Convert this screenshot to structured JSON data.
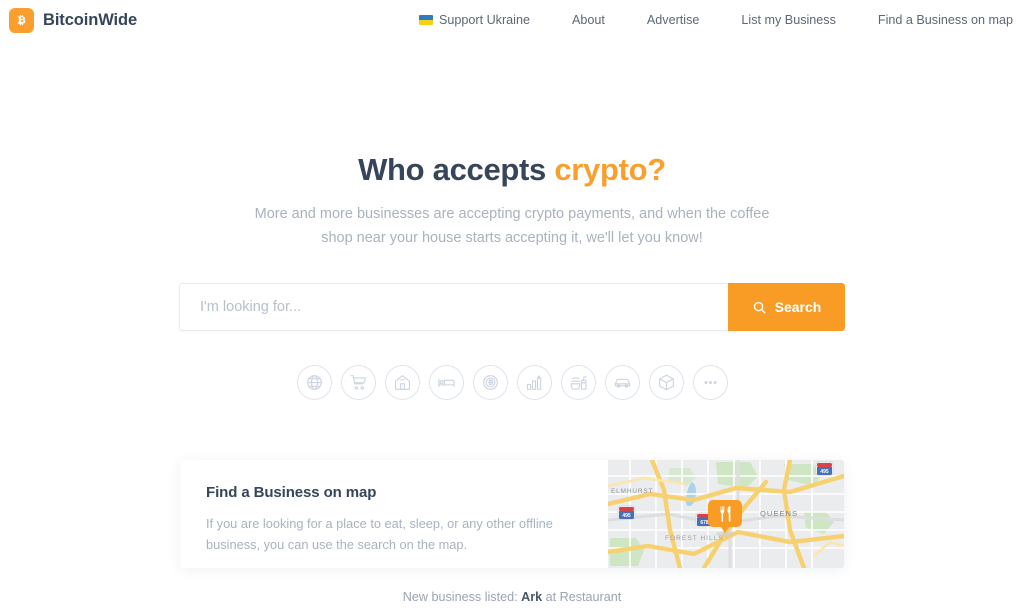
{
  "brand": {
    "name": "BitcoinWide",
    "logo_icon": "bitcoin-logo-icon",
    "logo_color": "#fa9f2e"
  },
  "nav": {
    "items": [
      {
        "label": "Support Ukraine",
        "icon": "ukraine-flag-icon"
      },
      {
        "label": "About",
        "icon": ""
      },
      {
        "label": "Advertise",
        "icon": ""
      },
      {
        "label": "List my Business",
        "icon": ""
      },
      {
        "label": "Find a Business on map",
        "icon": ""
      }
    ]
  },
  "hero": {
    "title_main": "Who accepts",
    "title_accent": "crypto?",
    "accent_color": "#fa9f2e",
    "subtitle_line1": "More and more businesses are accepting crypto payments, and when the coffee",
    "subtitle_line2": "shop near your house starts accepting it, we'll let you know!"
  },
  "search": {
    "placeholder": "I'm looking for...",
    "value": "",
    "button_label": "Search",
    "button_icon": "search-icon",
    "button_color": "#f89c26"
  },
  "categories": [
    {
      "name": "globe",
      "icon": "globe-icon"
    },
    {
      "name": "shopping",
      "icon": "shopping-cart-icon"
    },
    {
      "name": "home",
      "icon": "house-icon"
    },
    {
      "name": "lodging",
      "icon": "bed-icon"
    },
    {
      "name": "crypto",
      "icon": "bitcoin-coin-icon"
    },
    {
      "name": "finance",
      "icon": "bar-chart-arrow-icon"
    },
    {
      "name": "food",
      "icon": "fast-food-icon"
    },
    {
      "name": "automotive",
      "icon": "car-icon"
    },
    {
      "name": "goods",
      "icon": "box-icon"
    },
    {
      "name": "more",
      "icon": "ellipsis-icon"
    }
  ],
  "map_card": {
    "title": "Find a Business on map",
    "text_line1": "If you are looking for a place to eat, sleep, or any other offline",
    "text_line2": "business, you can use the search on the map.",
    "marker_icon": "restaurant-pin-icon",
    "marker_color": "#f89c26",
    "map_labels": [
      "ELMHURST",
      "QUEENS",
      "FOREST HILLS"
    ],
    "map_shields": [
      "495",
      "678",
      "495"
    ]
  },
  "ticker": {
    "prefix": "New business listed:",
    "business": "Ark",
    "suffix": "at Restaurant"
  }
}
